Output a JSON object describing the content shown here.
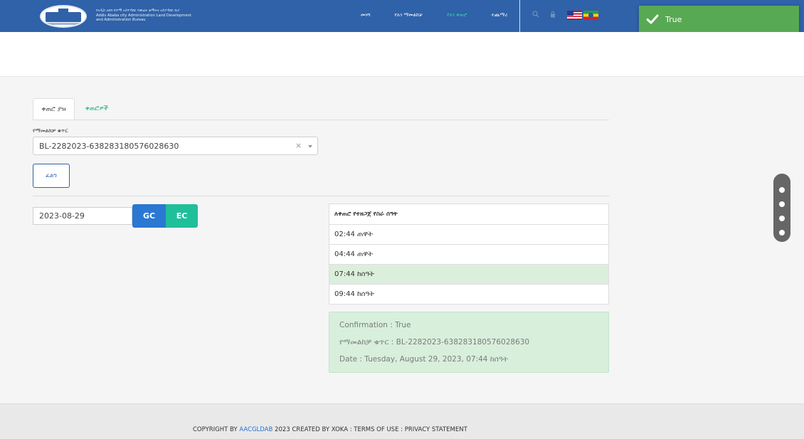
{
  "header": {
    "org_name_amharic": "የአዲስ አበባ ከተማ አስተዳደር የመሬት ልማትና አስተዳደር ቢሮ",
    "org_name_line2": "Addis Ababa city Administration Land Development",
    "org_name_line3": "and Administration Bureau",
    "nav": [
      {
        "label": "መነሻ"
      },
      {
        "label": "የአገ ማመልከቻ"
      },
      {
        "label": "የአገ ቀጠሮ"
      },
      {
        "label": "ተጨማሪ"
      }
    ],
    "active_nav_index": 2,
    "icons": [
      "search-icon",
      "lock-icon",
      "us-flag-icon",
      "ethiopia-flag-icon"
    ]
  },
  "toast": {
    "text": "True",
    "icon": "checkmark-icon",
    "color": "#58a953"
  },
  "tabs": [
    {
      "label": "ቀጠሮ ያዝ"
    },
    {
      "label": "ቀጠሮዎች"
    }
  ],
  "form": {
    "field_label": "የማመልከቻ ቁጥር",
    "application_number": "BL-2282023-638283180576028630",
    "clear_symbol": "×",
    "find_label": "ፈልግ"
  },
  "date": {
    "value": "2023-08-29",
    "gc_label": "GC",
    "ec_label": "EC"
  },
  "times": {
    "header": "ለቀጠሮ የተዘጋጀ የስራ ሰዓት",
    "slots": [
      "02:44 ጠዋት",
      "04:44 ጠዋት",
      "07:44 ከሰዓት",
      "09:44 ከሰዓት"
    ],
    "selected_index": 2
  },
  "confirmation": {
    "line1": "Confirmation : True",
    "line2": "የማመልከቻ ቁጥር : BL-2282023-638283180576028630",
    "line3": "Date : Tuesday, August 29, 2023, 07:44 ከሰዓት"
  },
  "footer": {
    "prefix": "COPYRIGHT BY ",
    "link": "AACGLDAB",
    "suffix": " 2023 CREATED BY XOKA : TERMS OF USE : PRIVACY STATEMENT"
  },
  "colors": {
    "header_bg": "#2f62a8",
    "accent_teal": "#1fbf9a",
    "gc_blue": "#2a78d2",
    "selected_row": "#dcefdc"
  }
}
